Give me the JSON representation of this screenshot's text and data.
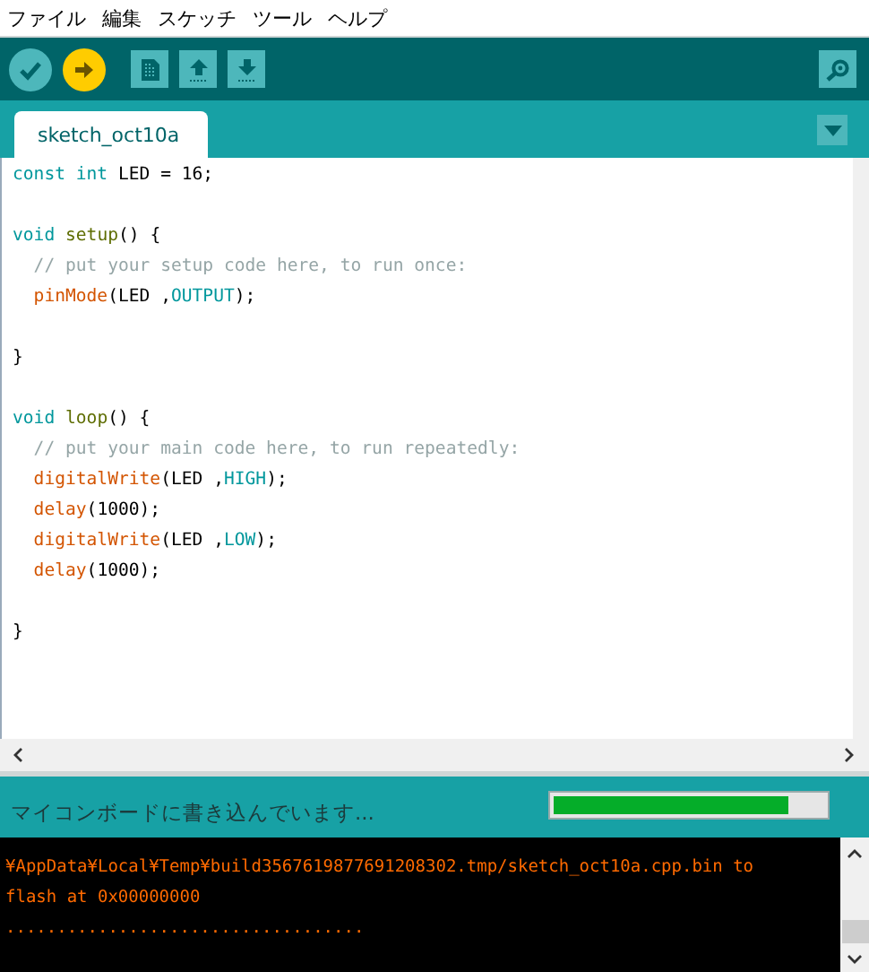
{
  "menu": [
    "ファイル",
    "編集",
    "スケッチ",
    "ツール",
    "ヘルプ"
  ],
  "toolbar": {
    "buttons": [
      {
        "kind": "verify"
      },
      {
        "kind": "upload"
      },
      {
        "kind": "new"
      },
      {
        "kind": "open"
      },
      {
        "kind": "save"
      }
    ]
  },
  "tabs": [
    {
      "label": "sketch_oct10a",
      "selected": true
    }
  ],
  "editor": {
    "lines": [
      {
        "kind": "code",
        "tokens": [
          {
            "text": "const int",
            "kind": "keyword"
          },
          {
            "text": " LED = 16;",
            "kind": "plain"
          }
        ]
      },
      {
        "kind": "blank"
      },
      {
        "kind": "code",
        "tokens": [
          {
            "text": "void ",
            "kind": "keyword"
          },
          {
            "text": "setup",
            "kind": "builtin"
          },
          {
            "text": "() {",
            "kind": "plain"
          }
        ]
      },
      {
        "kind": "code",
        "tokens": [
          {
            "text": "  // put your setup code here, to run once:",
            "kind": "comment"
          }
        ]
      },
      {
        "kind": "code",
        "tokens": [
          {
            "text": "  pinMode",
            "kind": "function"
          },
          {
            "text": "(LED ,",
            "kind": "plain"
          },
          {
            "text": "OUTPUT",
            "kind": "constant"
          },
          {
            "text": ");",
            "kind": "plain"
          }
        ]
      },
      {
        "kind": "blank"
      },
      {
        "kind": "code",
        "tokens": [
          {
            "text": "}",
            "kind": "plain"
          }
        ]
      },
      {
        "kind": "blank"
      },
      {
        "kind": "code",
        "tokens": [
          {
            "text": "void ",
            "kind": "keyword"
          },
          {
            "text": "loop",
            "kind": "builtin"
          },
          {
            "text": "() {",
            "kind": "plain"
          }
        ]
      },
      {
        "kind": "code",
        "tokens": [
          {
            "text": "  // put your main code here, to run repeatedly:",
            "kind": "comment"
          }
        ]
      },
      {
        "kind": "code",
        "tokens": [
          {
            "text": "  digitalWrite",
            "kind": "function"
          },
          {
            "text": "(LED ,",
            "kind": "plain"
          },
          {
            "text": "HIGH",
            "kind": "constant"
          },
          {
            "text": ");",
            "kind": "plain"
          }
        ]
      },
      {
        "kind": "code",
        "tokens": [
          {
            "text": "  delay",
            "kind": "function"
          },
          {
            "text": "(1000);",
            "kind": "plain"
          }
        ]
      },
      {
        "kind": "code",
        "tokens": [
          {
            "text": "  digitalWrite",
            "kind": "function"
          },
          {
            "text": "(LED ,",
            "kind": "plain"
          },
          {
            "text": "LOW",
            "kind": "constant"
          },
          {
            "text": ");",
            "kind": "plain"
          }
        ]
      },
      {
        "kind": "code",
        "tokens": [
          {
            "text": "  delay",
            "kind": "function"
          },
          {
            "text": "(1000);",
            "kind": "plain"
          }
        ]
      },
      {
        "kind": "blank"
      },
      {
        "kind": "code",
        "tokens": [
          {
            "text": "}",
            "kind": "plain"
          }
        ]
      }
    ]
  },
  "status_bar": {
    "message": "マイコンボードに書き込んでいます...",
    "level": 0.87
  },
  "console": {
    "lines": [
      "¥AppData¥Local¥Temp¥build3567619877691208302.tmp/sketch_oct10a.cpp.bin to",
      "flash at 0x00000000",
      "..................................."
    ]
  }
}
